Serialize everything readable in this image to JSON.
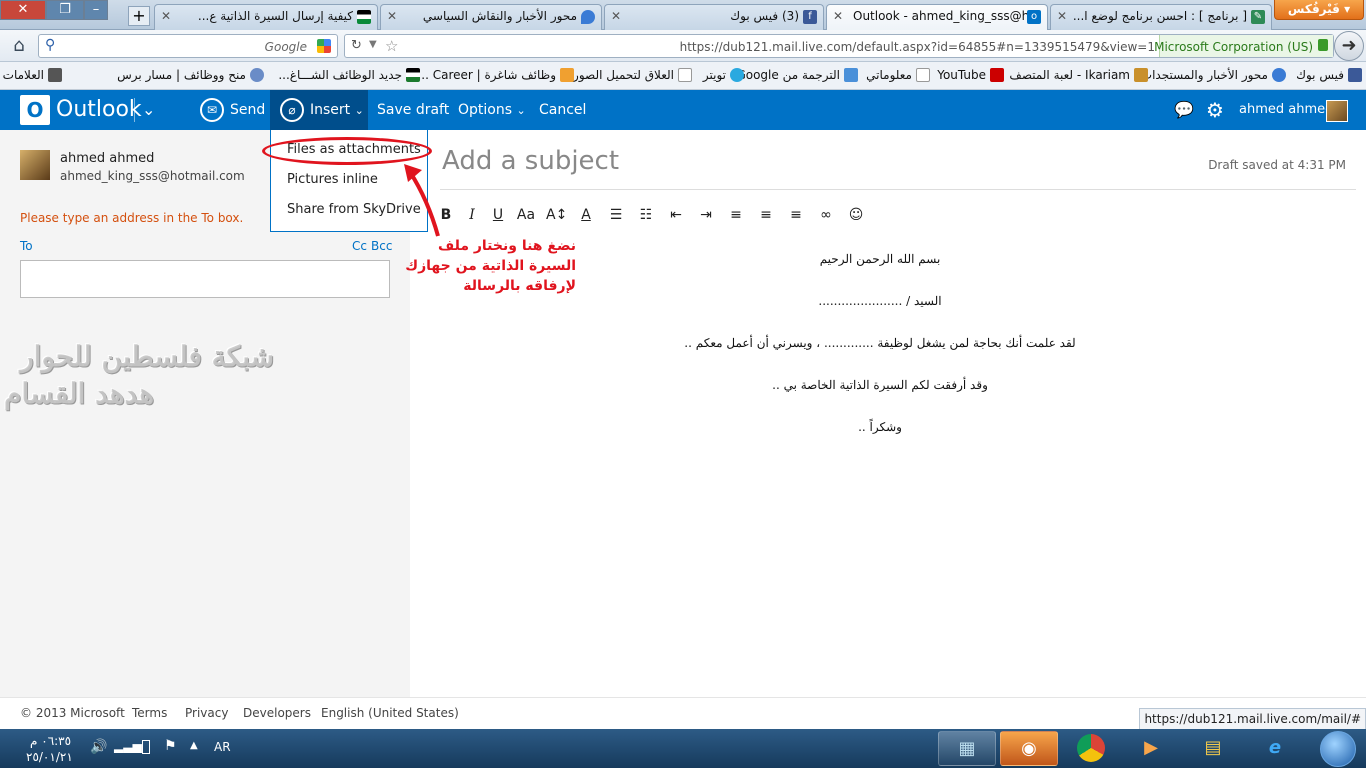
{
  "browser": {
    "menu_button": "فَيْرفُكس",
    "tabs": [
      {
        "title": "[ برنامج ] : احسن برنامج لوضع ا...",
        "active": false
      },
      {
        "title": "Outlook - ahmed_king_sss@hot",
        "active": true
      },
      {
        "title": "(3) فيس بوك",
        "active": false
      },
      {
        "title": "محور الأخبار والنقاش السياسي",
        "active": false
      },
      {
        "title": "كيفية إرسال السيرة الذاتية ع...",
        "active": false
      }
    ],
    "new_tab": "+",
    "search_engine": "Google",
    "url": "https://dub121.mail.live.com/default.aspx?id=64855#n=1339515479&view=1",
    "site_identity": "Microsoft Corporation (US)"
  },
  "bookmarks": [
    {
      "label": "فيس بوك",
      "color": "#3b5998"
    },
    {
      "label": "محور الأخبار والمستجدات",
      "color": "#3a7bd5"
    },
    {
      "label": "Ikariam - لعبة المتصف",
      "color": "#c9902b"
    },
    {
      "label": "YouTube",
      "color": "#cc0000"
    },
    {
      "label": "معلوماتي",
      "color": "#ffffff"
    },
    {
      "label": "الترجمة من Google",
      "color": "#4a90d9"
    },
    {
      "label": "تويتر",
      "color": "#2aa9e0"
    },
    {
      "label": "العلاق لتحميل الصور",
      "color": "#ffffff"
    },
    {
      "label": "وظائف شاغرة | Career ...",
      "color": "#f0a030"
    },
    {
      "label": "جديد الوظائف الشـــاغ...",
      "color": "#1b7a2e"
    },
    {
      "label": "منح ووظائف | مسار برس",
      "color": "#6a8cc7"
    },
    {
      "label": "العلامات",
      "color": "#555555"
    }
  ],
  "outlook": {
    "brand": "Outlook",
    "send": "Send",
    "insert": "Insert",
    "save_draft": "Save draft",
    "options": "Options",
    "cancel": "Cancel",
    "user_name": "ahmed ahmed",
    "accent": "#0072c6"
  },
  "insert_menu": {
    "items": [
      "Files as attachments",
      "Pictures inline",
      "Share from SkyDrive"
    ]
  },
  "sender": {
    "name": "ahmed ahmed",
    "email": "ahmed_king_sss@hotmail.com"
  },
  "compose": {
    "error": "Please type an address in the To box.",
    "to_label": "To",
    "cc": "Cc",
    "bcc": "Bcc",
    "subject_placeholder": "Add a subject",
    "draft_status": "Draft saved at 4:31 PM",
    "body": [
      "بسم الله الرحمن الرحيم",
      "السيد / ......................",
      "لقد علمت أنك بحاجة لمن يشغل لوظيفة ............. ، ويسرني أن أعمل معكم ..",
      "وقد أرفقت لكم السيرة الذاتية الخاصة بي ..",
      "وشكراً .."
    ]
  },
  "annotation": {
    "text_lines": [
      "نضغ هنا ونختار ملف",
      "السيرة الذاتية من جهازك",
      "لإرفاقه بالرسالة"
    ],
    "color": "#e0141e"
  },
  "watermark": [
    "شبكة فلسطين للحوار",
    "هدهد القسام"
  ],
  "footer": {
    "copyright": "© 2013 Microsoft",
    "links": [
      "Terms",
      "Privacy",
      "Developers",
      "English (United States)"
    ],
    "status_url": "https://dub121.mail.live.com/mail/#"
  },
  "taskbar": {
    "lang": "AR",
    "time": "٠٦:٣٥ م",
    "date": "٢٥/٠١/٢١"
  }
}
